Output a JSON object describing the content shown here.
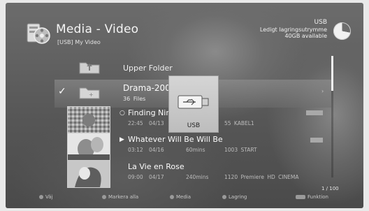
{
  "header": {
    "title": "Media - Video",
    "subtitle": "[USB]  My Video",
    "source_label": "USB",
    "storage_label": "Ledigt lagringsutrymme",
    "storage_value": "40GB available"
  },
  "list": {
    "upper_folder_label": "Upper Folder",
    "folder": {
      "name": "Drama-200",
      "files": "36 Files",
      "check": "✓"
    },
    "items": [
      {
        "title": "Finding Nim",
        "bullet": "○",
        "time": "22:45",
        "date": "04/13",
        "channel": "55 KABEL1"
      },
      {
        "title": "Whatever Will Be Will Be",
        "bullet": "▶",
        "time": "03:12",
        "date": "04/16",
        "duration": "60mins",
        "channel": "1003 START"
      },
      {
        "title": "La Vie en Rose",
        "time": "09:00",
        "date": "04/17",
        "duration": "240mins",
        "channel": "1120 Premiere HD CINEMA"
      }
    ],
    "folder_arrow": "›"
  },
  "usb_popup": {
    "label": "USB"
  },
  "pagination": "1 / 100",
  "footer": {
    "items": [
      "Väj",
      "Markera alla",
      "Media",
      "Lagring",
      "Funktion"
    ]
  },
  "colors": {
    "selection": "#8f8f8f",
    "text": "#f4f4f4"
  }
}
